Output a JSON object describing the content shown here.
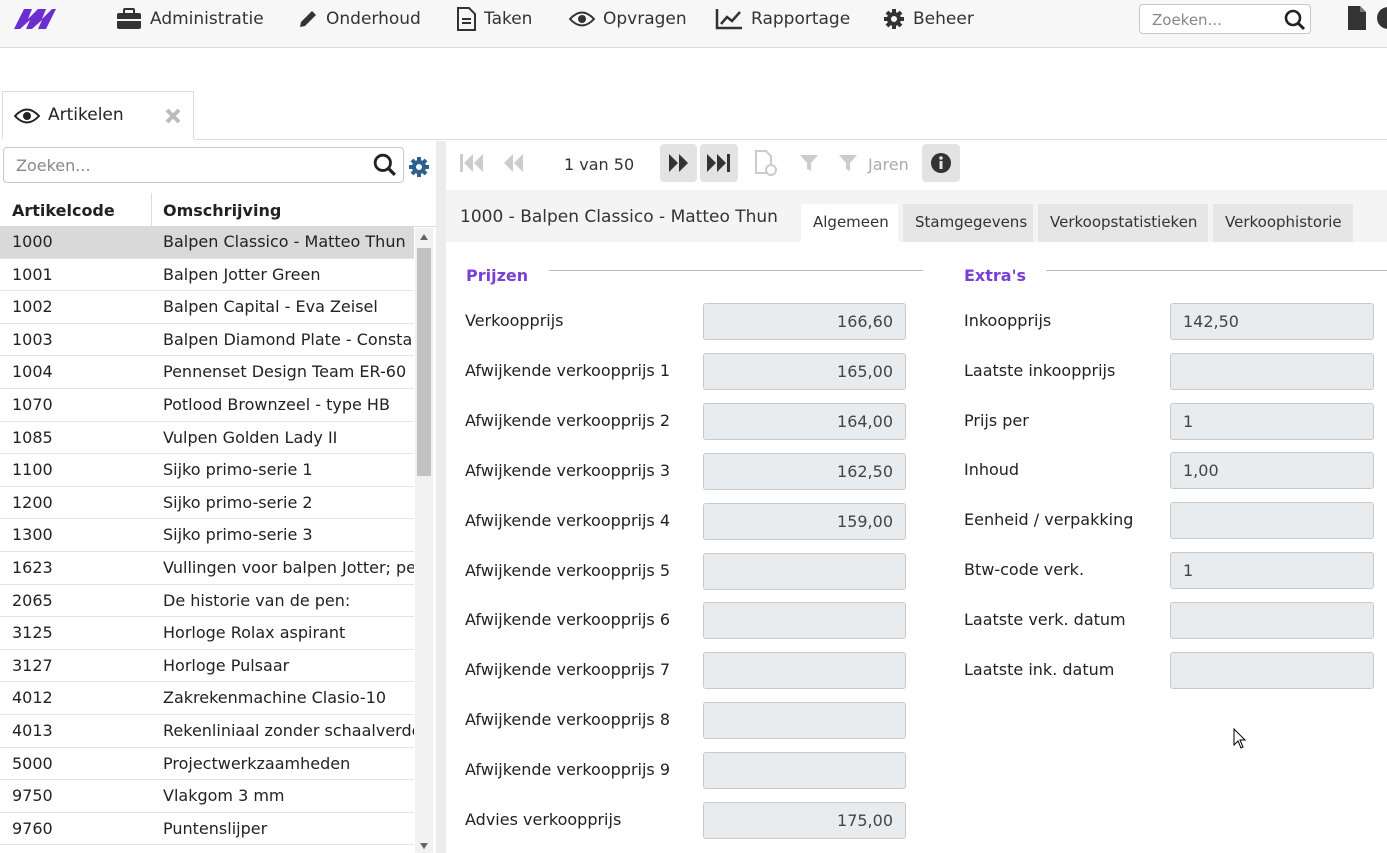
{
  "nav": {
    "items": [
      {
        "label": "Administratie",
        "icon": "briefcase-icon"
      },
      {
        "label": "Onderhoud",
        "icon": "pencil-icon"
      },
      {
        "label": "Taken",
        "icon": "document-icon"
      },
      {
        "label": "Opvragen",
        "icon": "eye-icon"
      },
      {
        "label": "Rapportage",
        "icon": "chart-line-icon"
      },
      {
        "label": "Beheer",
        "icon": "gear-icon"
      }
    ],
    "search_placeholder": "Zoeken..."
  },
  "tab": {
    "label": "Artikelen"
  },
  "list": {
    "search_placeholder": "Zoeken...",
    "headers": {
      "code": "Artikelcode",
      "desc": "Omschrijving"
    },
    "rows": [
      {
        "code": "1000",
        "desc": "Balpen Classico - Matteo Thun"
      },
      {
        "code": "1001",
        "desc": "Balpen Jotter Green"
      },
      {
        "code": "1002",
        "desc": "Balpen Capital - Eva Zeisel"
      },
      {
        "code": "1003",
        "desc": "Balpen Diamond Plate - Consta"
      },
      {
        "code": "1004",
        "desc": "Pennenset Design Team ER-60"
      },
      {
        "code": "1070",
        "desc": "Potlood Brownzeel - type HB"
      },
      {
        "code": "1085",
        "desc": "Vulpen Golden Lady II"
      },
      {
        "code": "1100",
        "desc": "Sijko primo-serie 1"
      },
      {
        "code": "1200",
        "desc": "Sijko primo-serie 2"
      },
      {
        "code": "1300",
        "desc": "Sijko primo-serie 3"
      },
      {
        "code": "1623",
        "desc": "Vullingen voor balpen Jotter; pe"
      },
      {
        "code": "2065",
        "desc": "De historie van de pen:"
      },
      {
        "code": "3125",
        "desc": "Horloge Rolax aspirant"
      },
      {
        "code": "3127",
        "desc": "Horloge Pulsaar"
      },
      {
        "code": "4012",
        "desc": "Zakrekenmachine Clasio-10"
      },
      {
        "code": "4013",
        "desc": "Rekenliniaal zonder schaalverde"
      },
      {
        "code": "5000",
        "desc": "Projectwerkzaamheden"
      },
      {
        "code": "9750",
        "desc": "Vlakgom 3 mm"
      },
      {
        "code": "9760",
        "desc": "Puntenslijper"
      }
    ]
  },
  "toolbar": {
    "pager": "1 van 50",
    "jaren": "Jaren"
  },
  "detail": {
    "title": "1000 - Balpen Classico - Matteo Thun",
    "tabs": [
      "Algemeen",
      "Stamgegevens",
      "Verkoopstatistieken",
      "Verkoophistorie"
    ],
    "prijzen": {
      "title": "Prijzen",
      "fields": [
        {
          "label": "Verkoopprijs",
          "value": "166,60"
        },
        {
          "label": "Afwijkende verkoopprijs 1",
          "value": "165,00"
        },
        {
          "label": "Afwijkende verkoopprijs 2",
          "value": "164,00"
        },
        {
          "label": "Afwijkende verkoopprijs 3",
          "value": "162,50"
        },
        {
          "label": "Afwijkende verkoopprijs 4",
          "value": "159,00"
        },
        {
          "label": "Afwijkende verkoopprijs 5",
          "value": ""
        },
        {
          "label": "Afwijkende verkoopprijs 6",
          "value": ""
        },
        {
          "label": "Afwijkende verkoopprijs 7",
          "value": ""
        },
        {
          "label": "Afwijkende verkoopprijs 8",
          "value": ""
        },
        {
          "label": "Afwijkende verkoopprijs 9",
          "value": ""
        },
        {
          "label": "Advies verkoopprijs",
          "value": "175,00"
        }
      ]
    },
    "extras": {
      "title": "Extra's",
      "fields": [
        {
          "label": "Inkoopprijs",
          "value": "142,50"
        },
        {
          "label": "Laatste inkoopprijs",
          "value": ""
        },
        {
          "label": "Prijs per",
          "value": "1"
        },
        {
          "label": "Inhoud",
          "value": "1,00"
        },
        {
          "label": "Eenheid / verpakking",
          "value": ""
        },
        {
          "label": "Btw-code verk.",
          "value": "1"
        },
        {
          "label": "Laatste verk. datum",
          "value": ""
        },
        {
          "label": "Laatste ink. datum",
          "value": ""
        }
      ]
    }
  },
  "colors": {
    "accent": "#7b3fd6",
    "gear": "#2c5f8a"
  }
}
